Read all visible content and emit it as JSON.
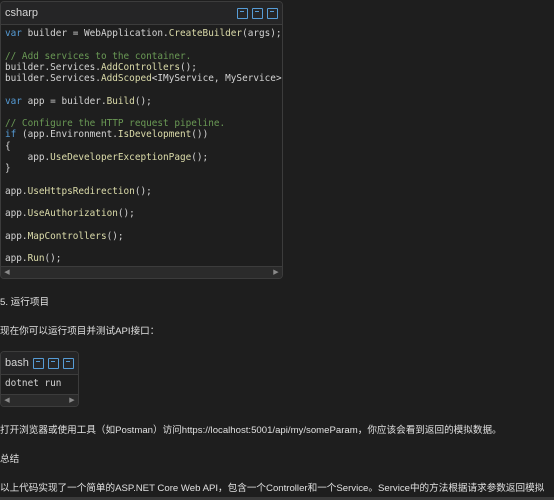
{
  "csharp_block": {
    "language": "csharp",
    "lines": [
      [
        {
          "t": "var",
          "c": "kw"
        },
        {
          "t": " builder = WebApplication."
        },
        {
          "t": "CreateBuilder",
          "c": "fn"
        },
        {
          "t": "(args);"
        }
      ],
      [],
      [
        {
          "t": "// Add services to the container.",
          "c": "cm"
        }
      ],
      [
        {
          "t": "builder.Services."
        },
        {
          "t": "AddControllers",
          "c": "fn"
        },
        {
          "t": "();"
        }
      ],
      [
        {
          "t": "builder.Services."
        },
        {
          "t": "AddScoped",
          "c": "fn"
        },
        {
          "t": "<IMyService, MyService>();"
        }
      ],
      [],
      [
        {
          "t": "var",
          "c": "kw"
        },
        {
          "t": " app = builder."
        },
        {
          "t": "Build",
          "c": "fn"
        },
        {
          "t": "();"
        }
      ],
      [],
      [
        {
          "t": "// Configure the HTTP request pipeline.",
          "c": "cm"
        }
      ],
      [
        {
          "t": "if",
          "c": "kw"
        },
        {
          "t": " (app.Environment."
        },
        {
          "t": "IsDevelopment",
          "c": "fn"
        },
        {
          "t": "())"
        }
      ],
      [
        {
          "t": "{"
        }
      ],
      [
        {
          "t": "    app."
        },
        {
          "t": "UseDeveloperExceptionPage",
          "c": "fn"
        },
        {
          "t": "();"
        }
      ],
      [
        {
          "t": "}"
        }
      ],
      [],
      [
        {
          "t": "app."
        },
        {
          "t": "UseHttpsRedirection",
          "c": "fn"
        },
        {
          "t": "();"
        }
      ],
      [],
      [
        {
          "t": "app."
        },
        {
          "t": "UseAuthorization",
          "c": "fn"
        },
        {
          "t": "();"
        }
      ],
      [],
      [
        {
          "t": "app."
        },
        {
          "t": "MapControllers",
          "c": "fn"
        },
        {
          "t": "();"
        }
      ],
      [],
      [
        {
          "t": "app."
        },
        {
          "t": "Run",
          "c": "fn"
        },
        {
          "t": "();"
        }
      ]
    ]
  },
  "section_heading": "5. 运行项目",
  "intro_text": "现在你可以运行项目并测试API接口：",
  "bash_block": {
    "language": "bash",
    "lines": [
      [
        {
          "t": "dotnet run"
        }
      ]
    ]
  },
  "instruction_text": "打开浏览器或使用工具（如Postman）访问https://localhost:5001/api/my/someParam，你应该会看到返回的模拟数据。",
  "summary_heading": "总结",
  "summary_text": "以上代码实现了一个简单的ASP.NET Core Web API，包含一个Controller和一个Service。Service中的方法根据请求参数返回模拟"
}
